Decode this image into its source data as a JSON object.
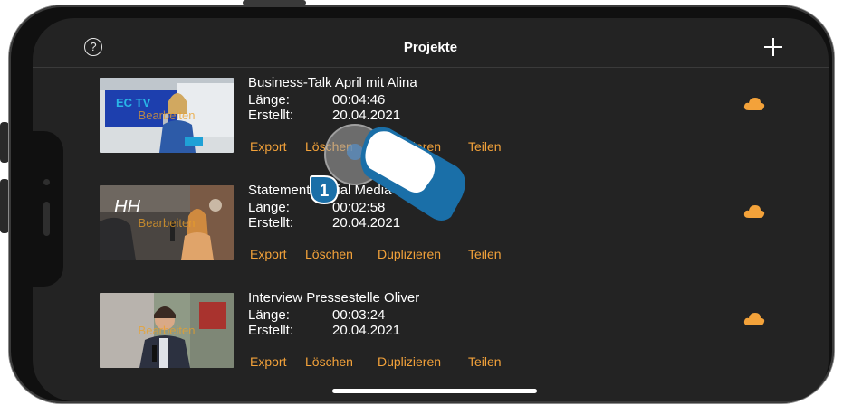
{
  "header": {
    "title": "Projekte",
    "help_icon": "help-circle-icon",
    "add_icon": "plus-icon",
    "help_glyph": "?"
  },
  "projects": [
    {
      "title": "Business-Talk April mit Alina",
      "length_label": "Länge:",
      "length_value": "00:04:46",
      "created_label": "Erstellt:",
      "created_value": "20.04.2021",
      "thumb_caption": "Bearbeiten",
      "thumb_logo": "EC TV",
      "actions": {
        "export": "Export",
        "delete": "Löschen",
        "duplicate": "Duplizieren",
        "share": "Teilen"
      },
      "status_icon": "cloud-icon"
    },
    {
      "title": "Statement Social Media",
      "length_label": "Länge:",
      "length_value": "00:02:58",
      "created_label": "Erstellt:",
      "created_value": "20.04.2021",
      "thumb_caption": "Bearbeiten",
      "thumb_logo": "HH",
      "actions": {
        "export": "Export",
        "delete": "Löschen",
        "duplicate": "Duplizieren",
        "share": "Teilen"
      },
      "status_icon": "cloud-icon"
    },
    {
      "title": "Interview Pressestelle Oliver",
      "length_label": "Länge:",
      "length_value": "00:03:24",
      "created_label": "Erstellt:",
      "created_value": "20.04.2021",
      "thumb_caption": "Bearbeiten",
      "actions": {
        "export": "Export",
        "delete": "Löschen",
        "duplicate": "Duplizieren",
        "share": "Teilen"
      },
      "status_icon": "cloud-icon"
    }
  ],
  "overlay": {
    "step_number": "1",
    "gesture_icon": "tap-finger-icon"
  },
  "colors": {
    "background": "#232323",
    "accent": "#f3a23a",
    "text": "#ffffff",
    "badge": "#1a6fa8"
  }
}
